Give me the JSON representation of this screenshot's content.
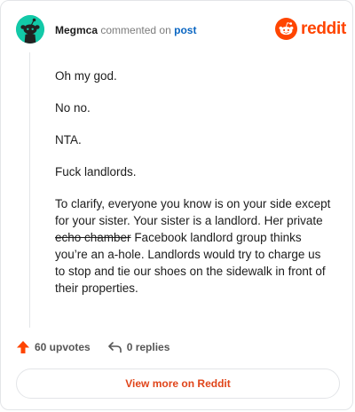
{
  "header": {
    "author": "Megmca",
    "verb": "commented on",
    "link": "post",
    "logo_text": "reddit"
  },
  "comment": {
    "paragraphs": [
      "Oh my god.",
      "No no.",
      "NTA.",
      "Fuck landlords."
    ],
    "last_paragraph": {
      "part1": "To clarify, everyone you know is on your side except for your sister. Your sister is a landlord. Her private ",
      "struck": "echo chamber",
      "part2": " Facebook landlord group thinks you’re an a-hole. Landlords would try to charge us to stop and tie our shoes on the sidewalk in front of their properties."
    }
  },
  "footer": {
    "upvotes": "60 upvotes",
    "replies": "0 replies",
    "view_more": "View more on Reddit"
  },
  "colors": {
    "brand": "#ff4500",
    "avatar": "#12c9a8",
    "link": "#0a66c2"
  },
  "icons": [
    "snoo-avatar-icon",
    "reddit-logo-icon",
    "upvote-arrow-icon",
    "reply-arrow-icon"
  ]
}
